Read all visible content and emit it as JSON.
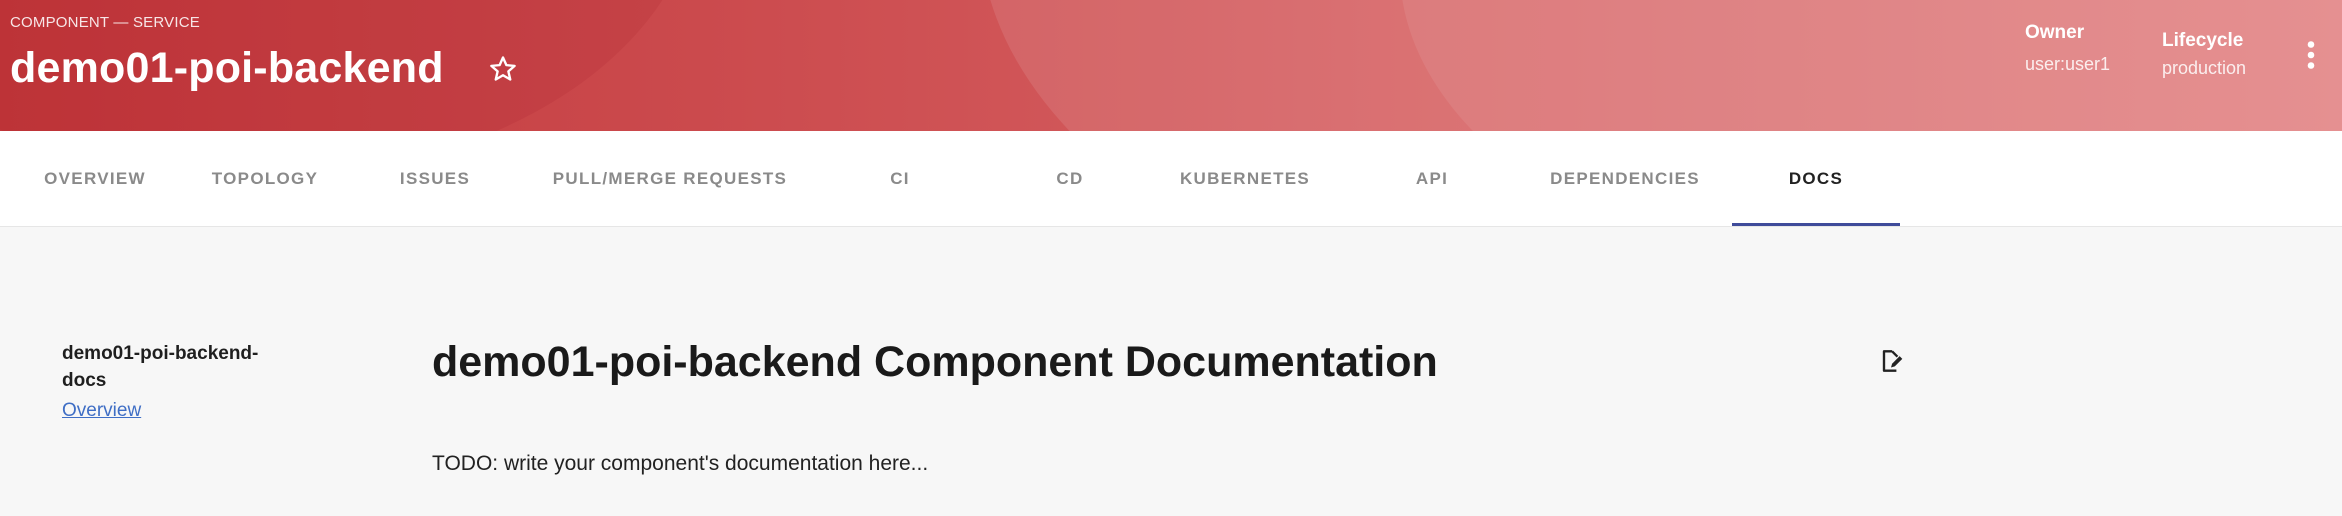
{
  "header": {
    "type_label": "COMPONENT — SERVICE",
    "title": "demo01-poi-backend",
    "star_icon": "star-outline-icon",
    "owner_label": "Owner",
    "owner_value": "user:user1",
    "lifecycle_label": "Lifecycle",
    "lifecycle_value": "production",
    "more_icon": "more-vertical-icon",
    "colors": {
      "start": "#c2383b",
      "end": "#e07a7b"
    }
  },
  "tabs": [
    {
      "label": "OVERVIEW"
    },
    {
      "label": "TOPOLOGY"
    },
    {
      "label": "ISSUES"
    },
    {
      "label": "PULL/MERGE REQUESTS"
    },
    {
      "label": "CI"
    },
    {
      "label": "CD"
    },
    {
      "label": "KUBERNETES"
    },
    {
      "label": "API"
    },
    {
      "label": "DEPENDENCIES"
    },
    {
      "label": "DOCS",
      "active": true
    }
  ],
  "sidebar": {
    "title": "demo01-poi-backend-docs",
    "link": "Overview"
  },
  "doc": {
    "title": "demo01-poi-backend Component Documentation",
    "body": "TODO: write your component's documentation here...",
    "edit_icon": "edit-document-icon"
  },
  "colors": {
    "tab_indicator": "#3f4b9a",
    "link": "#3f6ec5"
  }
}
